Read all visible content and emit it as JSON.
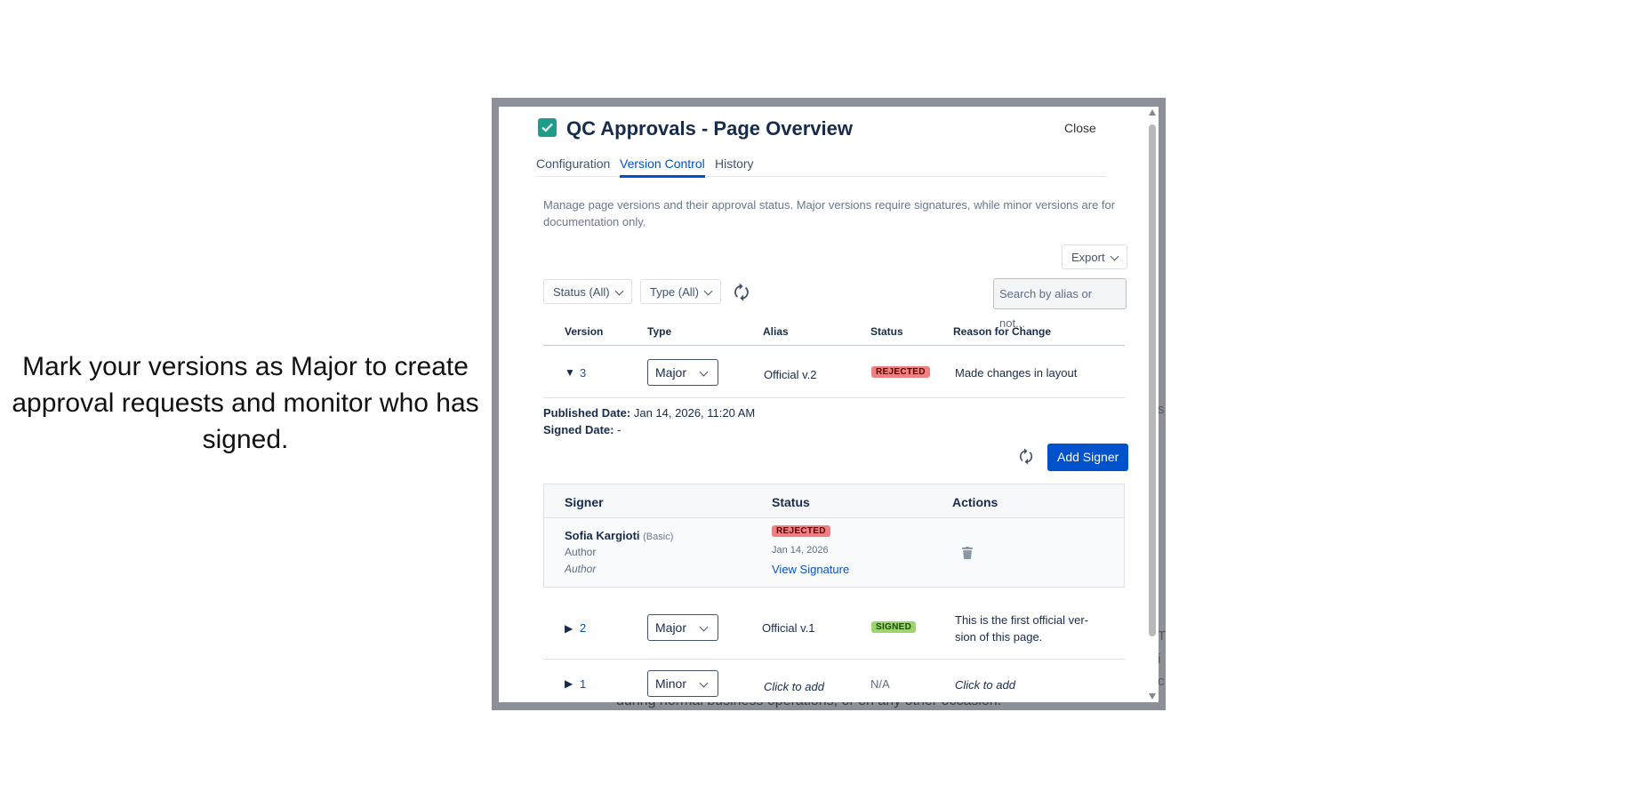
{
  "caption": "Mark your versions as Major to create approval requests and monitor who has signed.",
  "background_text": "during normal business operations, or on any other occasion.",
  "background_edge_chars": [
    "s",
    "T",
    "i",
    "c"
  ],
  "modal": {
    "title": "QC Approvals - Page Overview",
    "close_label": "Close",
    "tabs": [
      {
        "label": "Configuration",
        "active": false
      },
      {
        "label": "Version Control",
        "active": true
      },
      {
        "label": "History",
        "active": false
      }
    ],
    "description": "Manage page versions and their approval status. Major versions require signatures, while minor versions are for documentation only.",
    "export_label": "Export",
    "filters": {
      "status": "Status (All)",
      "type": "Type (All)"
    },
    "search_placeholder": "Search by alias or not...",
    "table_headers": [
      "Version",
      "Type",
      "Alias",
      "Status",
      "Reason for Change"
    ],
    "versions": [
      {
        "version": "3",
        "expanded": true,
        "type": "Major",
        "alias": "Official v.2",
        "status": "REJECTED",
        "reason": "Made changes in layout",
        "published_label": "Published Date:",
        "published_value": "Jan 14, 2026, 11:20 AM",
        "signed_label": "Signed Date:",
        "signed_value": "-",
        "add_signer_label": "Add Signer",
        "signer_headers": [
          "Signer",
          "Status",
          "Actions"
        ],
        "signers": [
          {
            "name": "Sofia Kargioti",
            "license": "(Basic)",
            "role": "Author",
            "role_italic": "Author",
            "status": "REJECTED",
            "date": "Jan 14, 2026",
            "view_label": "View Signature"
          }
        ]
      },
      {
        "version": "2",
        "expanded": false,
        "type": "Major",
        "alias": "Official v.1",
        "status": "SIGNED",
        "reason_line1": "This is the first official ver-",
        "reason_line2": "sion of this page."
      },
      {
        "version": "1",
        "expanded": false,
        "type": "Minor",
        "alias": "Click to add",
        "status": "N/A",
        "reason": "Click to add"
      }
    ],
    "icons": {
      "expanded": "▼",
      "collapsed": "▶",
      "refresh": "🗘",
      "trash": "trash-icon"
    },
    "colors": {
      "primary": "#0052cc",
      "rejected": "#f08080",
      "signed": "#9ad66d",
      "check": "#1f9d8a"
    }
  }
}
